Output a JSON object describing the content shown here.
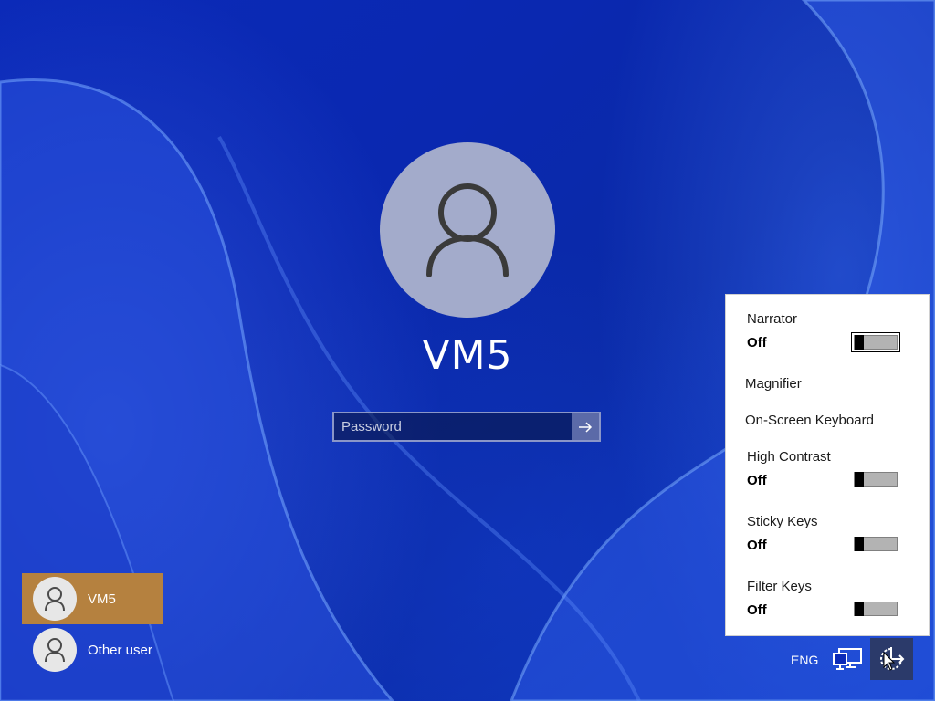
{
  "login": {
    "username": "VM5",
    "password_placeholder": "Password"
  },
  "user_list": [
    {
      "label": "VM5",
      "selected": true
    },
    {
      "label": "Other user",
      "selected": false
    }
  ],
  "ease_of_access": {
    "narrator": {
      "label": "Narrator",
      "state": "Off"
    },
    "magnifier": {
      "label": "Magnifier"
    },
    "on_screen_keyboard": {
      "label": "On-Screen Keyboard"
    },
    "high_contrast": {
      "label": "High Contrast",
      "state": "Off"
    },
    "sticky_keys": {
      "label": "Sticky Keys",
      "state": "Off"
    },
    "filter_keys": {
      "label": "Filter Keys",
      "state": "Off"
    }
  },
  "tray": {
    "language": "ENG",
    "network_icon": "network-icon",
    "ease_icon": "ease-of-access-icon"
  },
  "colors": {
    "selected_tile": "#b5813f",
    "background": "#0b2ab8",
    "avatar": "#a3abcb"
  }
}
